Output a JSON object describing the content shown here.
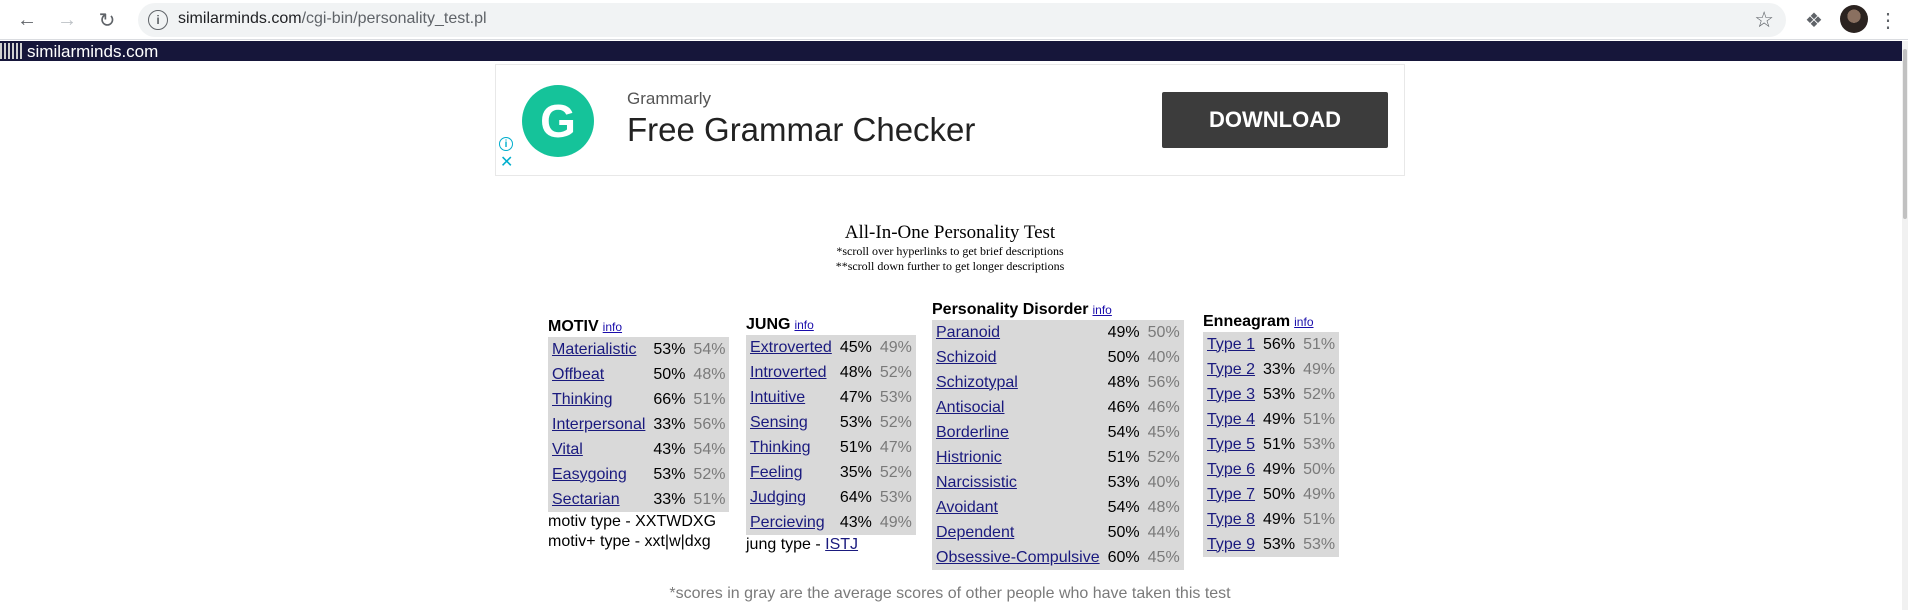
{
  "browser": {
    "url_domain": "similarminds.com",
    "url_path": "/cgi-bin/personality_test.pl"
  },
  "site": {
    "name": "similarminds.com"
  },
  "ad": {
    "brand": "Grammarly",
    "headline": "Free Grammar Checker",
    "button": "DOWNLOAD",
    "logo_letter": "G",
    "accent_color": "#15c39a"
  },
  "page": {
    "title": "All-In-One Personality Test",
    "sub1": "*scroll over hyperlinks to get brief descriptions",
    "sub2": "**scroll down further to get longer descriptions",
    "footnote": "*scores in gray are the average scores of other people who have taken this test"
  },
  "motiv": {
    "heading": "MOTIV",
    "info": "info",
    "rows": [
      {
        "name": "Materialistic",
        "score": "53%",
        "avg": "54%"
      },
      {
        "name": "Offbeat",
        "score": "50%",
        "avg": "48%"
      },
      {
        "name": "Thinking",
        "score": "66%",
        "avg": "51%"
      },
      {
        "name": "Interpersonal",
        "score": "33%",
        "avg": "56%"
      },
      {
        "name": "Vital",
        "score": "43%",
        "avg": "54%"
      },
      {
        "name": "Easygoing",
        "score": "53%",
        "avg": "52%"
      },
      {
        "name": "Sectarian",
        "score": "33%",
        "avg": "51%"
      }
    ],
    "type_line": "motiv type - XXTWDXG",
    "type_plus_line": "motiv+ type - xxt|w|dxg"
  },
  "jung": {
    "heading": "JUNG",
    "info": "info",
    "rows": [
      {
        "name": "Extroverted",
        "score": "45%",
        "avg": "49%"
      },
      {
        "name": "Introverted",
        "score": "48%",
        "avg": "52%"
      },
      {
        "name": "Intuitive",
        "score": "47%",
        "avg": "53%"
      },
      {
        "name": "Sensing",
        "score": "53%",
        "avg": "52%"
      },
      {
        "name": "Thinking",
        "score": "51%",
        "avg": "47%"
      },
      {
        "name": "Feeling",
        "score": "35%",
        "avg": "52%"
      },
      {
        "name": "Judging",
        "score": "64%",
        "avg": "53%"
      },
      {
        "name": "Percieving",
        "score": "43%",
        "avg": "49%"
      }
    ],
    "type_label": "jung type - ",
    "type_value": "ISTJ"
  },
  "disorder": {
    "heading": "Personality Disorder",
    "info": "info",
    "rows": [
      {
        "name": "Paranoid",
        "score": "49%",
        "avg": "50%"
      },
      {
        "name": "Schizoid",
        "score": "50%",
        "avg": "40%"
      },
      {
        "name": "Schizotypal",
        "score": "48%",
        "avg": "56%"
      },
      {
        "name": "Antisocial",
        "score": "46%",
        "avg": "46%"
      },
      {
        "name": "Borderline",
        "score": "54%",
        "avg": "45%"
      },
      {
        "name": "Histrionic",
        "score": "51%",
        "avg": "52%"
      },
      {
        "name": "Narcissistic",
        "score": "53%",
        "avg": "40%"
      },
      {
        "name": "Avoidant",
        "score": "54%",
        "avg": "48%"
      },
      {
        "name": "Dependent",
        "score": "50%",
        "avg": "44%"
      },
      {
        "name": "Obsessive-Compulsive",
        "score": "60%",
        "avg": "45%"
      }
    ]
  },
  "enneagram": {
    "heading": "Enneagram",
    "info": "info",
    "rows": [
      {
        "name": "Type 1",
        "score": "56%",
        "avg": "51%"
      },
      {
        "name": "Type 2",
        "score": "33%",
        "avg": "49%"
      },
      {
        "name": "Type 3",
        "score": "53%",
        "avg": "52%"
      },
      {
        "name": "Type 4",
        "score": "49%",
        "avg": "51%"
      },
      {
        "name": "Type 5",
        "score": "51%",
        "avg": "53%"
      },
      {
        "name": "Type 6",
        "score": "49%",
        "avg": "50%"
      },
      {
        "name": "Type 7",
        "score": "50%",
        "avg": "49%"
      },
      {
        "name": "Type 8",
        "score": "49%",
        "avg": "51%"
      },
      {
        "name": "Type 9",
        "score": "53%",
        "avg": "53%"
      }
    ]
  }
}
